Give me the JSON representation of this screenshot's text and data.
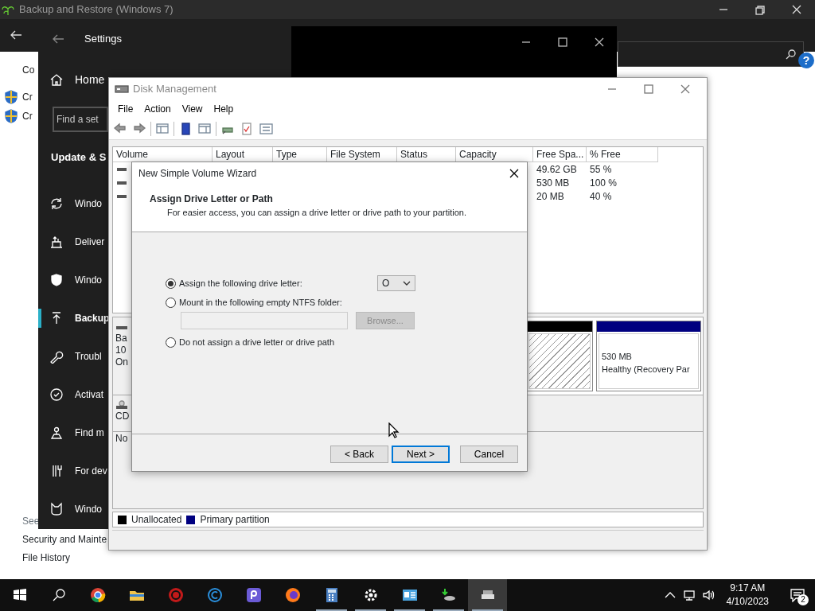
{
  "backup_window": {
    "title": "Backup and Restore (Windows 7)",
    "help_button": "?",
    "content": [
      {
        "kind": "text",
        "label": "Co"
      },
      {
        "kind": "shield",
        "label": "Cr"
      },
      {
        "kind": "shield",
        "label": "Cr"
      }
    ],
    "see_also": "See",
    "links": [
      "Security and Mainte",
      "File History"
    ]
  },
  "settings_window": {
    "title": "Settings",
    "home": "Home",
    "search": {
      "placeholder": "Find a set"
    },
    "section": "Update & S",
    "items": [
      {
        "kind": "sync",
        "label": "Windo",
        "selected": false
      },
      {
        "kind": "delivery",
        "label": "Deliver",
        "selected": false
      },
      {
        "kind": "shield",
        "label": "Windo",
        "selected": false
      },
      {
        "kind": "backup",
        "label": "Backup",
        "selected": true
      },
      {
        "kind": "wrench",
        "label": "Troubl",
        "selected": false
      },
      {
        "kind": "activation",
        "label": "Activat",
        "selected": false
      },
      {
        "kind": "find",
        "label": "Find m",
        "selected": false
      },
      {
        "kind": "developer",
        "label": "For dev",
        "selected": false
      },
      {
        "kind": "insider",
        "label": "Windo",
        "selected": false
      }
    ]
  },
  "disk_management": {
    "title": "Disk Management",
    "menu": [
      "File",
      "Action",
      "View",
      "Help"
    ],
    "columns": [
      "Volume",
      "Layout",
      "Type",
      "File System",
      "Status",
      "Capacity",
      "Free Spa...",
      "% Free"
    ],
    "rows": [
      {
        "free_space": "49.62 GB",
        "percent_free": "55 %"
      },
      {
        "free_space": "530 MB",
        "percent_free": "100 %"
      },
      {
        "free_space": "20 MB",
        "percent_free": "40 %"
      }
    ],
    "disks": [
      {
        "kind": "basic",
        "lines": [
          "Ba",
          "10",
          "On"
        ],
        "partitions": [
          {
            "kind": "unallocated",
            "color": "#000000"
          },
          {
            "kind": "primary",
            "color": "#000080",
            "size": "530 MB",
            "status": "Healthy (Recovery Par"
          }
        ]
      },
      {
        "kind": "cdrom",
        "lines": [
          "CD",
          "No"
        ]
      }
    ],
    "legend": [
      {
        "label": "Unallocated",
        "color": "#000000"
      },
      {
        "label": "Primary partition",
        "color": "#000080"
      }
    ]
  },
  "wizard": {
    "title": "New Simple Volume Wizard",
    "heading": "Assign Drive Letter or Path",
    "subheading": "For easier access, you can assign a drive letter or drive path to your partition.",
    "options": [
      {
        "kind": "letter",
        "label": "Assign the following drive letter:",
        "selected": true
      },
      {
        "kind": "folder",
        "label": "Mount in the following empty NTFS folder:",
        "selected": false
      },
      {
        "kind": "none",
        "label": "Do not assign a drive letter or drive path",
        "selected": false
      }
    ],
    "drive_letter": "O",
    "browse": {
      "label": "Browse...",
      "disabled": true
    },
    "buttons": [
      {
        "label": "< Back",
        "default": false
      },
      {
        "label": "Next >",
        "default": true
      },
      {
        "label": "Cancel",
        "default": false
      }
    ]
  },
  "taskbar": {
    "apps": [
      {
        "kind": "chrome",
        "running": false,
        "active": false
      },
      {
        "kind": "folder",
        "running": false,
        "active": false
      },
      {
        "kind": "red",
        "running": false,
        "active": false
      },
      {
        "kind": "ring",
        "running": false,
        "active": false
      },
      {
        "kind": "purple",
        "running": false,
        "active": false
      },
      {
        "kind": "firefox",
        "running": false,
        "active": false
      },
      {
        "kind": "calculator",
        "running": true,
        "active": false
      },
      {
        "kind": "gear",
        "running": true,
        "active": false
      },
      {
        "kind": "panel",
        "running": true,
        "active": false
      },
      {
        "kind": "backup",
        "running": true,
        "active": false
      },
      {
        "kind": "disk",
        "running": true,
        "active": true
      }
    ],
    "time": "9:17 AM",
    "date": "4/10/2023",
    "notifications": "2"
  }
}
